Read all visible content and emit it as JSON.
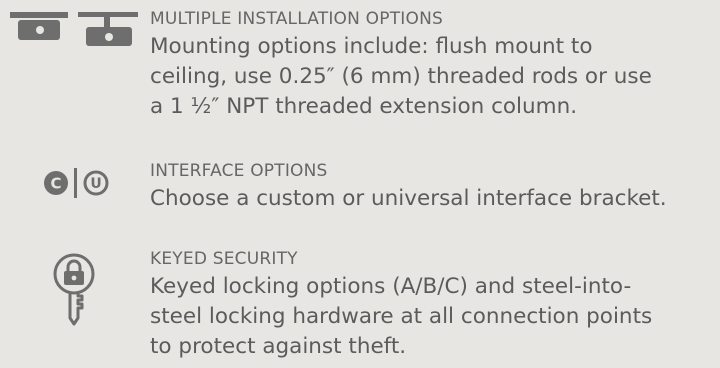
{
  "features": [
    {
      "icon": "ceiling-mount-icon",
      "title": "MULTIPLE INSTALLATION OPTIONS",
      "description_lines": [
        "Mounting options include: flush mount to",
        "ceiling, use 0.25″ (6 mm) threaded rods or use",
        "a 1 ½″ NPT threaded extension column."
      ]
    },
    {
      "icon": "custom-universal-interface-icon",
      "icon_letters": [
        "C",
        "U"
      ],
      "title": "INTERFACE OPTIONS",
      "description_lines": [
        "Choose a custom or universal interface bracket."
      ]
    },
    {
      "icon": "key-lock-icon",
      "title": "KEYED SECURITY",
      "description_lines": [
        "Keyed locking options (A/B/C) and steel-into-",
        "steel locking hardware at all connection points",
        "to protect against theft."
      ]
    }
  ],
  "colors": {
    "background": "#e8e6e3",
    "icon": "#6e6e6e",
    "text": "#5b5b5b"
  }
}
